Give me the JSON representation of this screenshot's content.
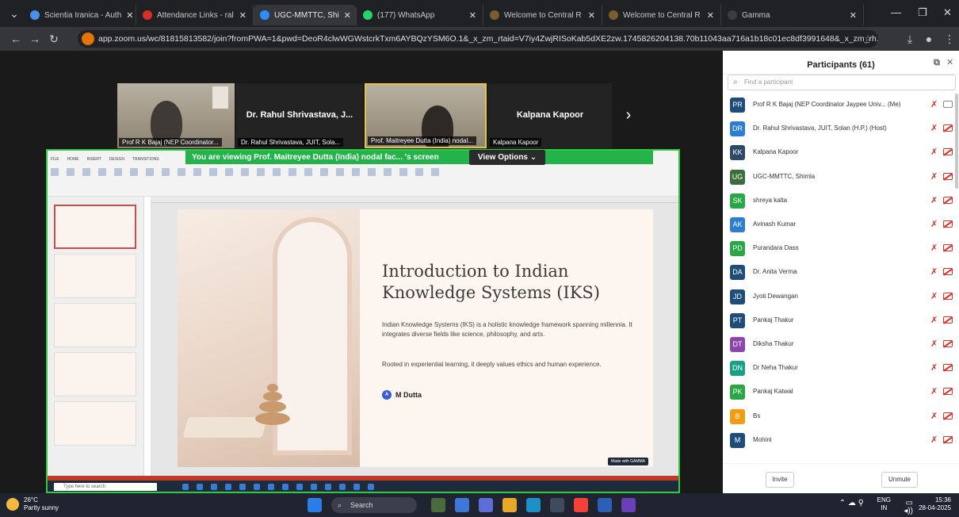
{
  "browser": {
    "tabs": [
      {
        "label": "Scientia Iranica - Auth",
        "color": "#4a8fe8"
      },
      {
        "label": "Attendance Links - ral",
        "color": "#d93025"
      },
      {
        "label": "UGC-MMTTC, Shi",
        "color": "#2d8cff",
        "active": true
      },
      {
        "label": "(177) WhatsApp",
        "color": "#25d366"
      },
      {
        "label": "Welcome to Central R",
        "color": "#7a5c2e"
      },
      {
        "label": "Welcome to Central R",
        "color": "#7a5c2e"
      },
      {
        "label": "Gamma",
        "color": "#3c3c3c"
      }
    ],
    "url": "app.zoom.us/wc/81815813582/join?fromPWA=1&pwd=DeoR4clwWGWstcrkTxm6AYBQzYSM6O.1&_x_zm_rtaid=V7iy4ZwjRISoKab5dXE2zw.1745826204138.70b11043aa716a1b18c01ec8df3991648&_x_zm_rh..."
  },
  "videos": [
    {
      "label": "Prof R K Bajaj (NEP Coordinator..."
    },
    {
      "name": "Dr. Rahul Shrivastava, J...",
      "label": "Dr. Rahul Shrivastava, JUIT, Sola..."
    },
    {
      "label": "Prof. Maitreyee Dutta (India) nodal..."
    },
    {
      "name": "Kalpana Kapoor",
      "label": "Kalpana Kapoor"
    }
  ],
  "share": {
    "banner": "You are viewing Prof. Maitreyee Dutta (India) nodal fac... 's screen",
    "view_options": "View Options",
    "slide": {
      "title": "Introduction to Indian Knowledge Systems (IKS)",
      "para1": "Indian Knowledge Systems (IKS) is a holistic knowledge framework spanning millennia. It integrates diverse fields like science, philosophy, and arts.",
      "para2": "Rooted in experiential learning, it deeply values ethics and human experience.",
      "author_initial": "A",
      "author": "M Dutta",
      "badge": "Made with GAMMA"
    },
    "inner_search": "Type here to search"
  },
  "participants": {
    "title": "Participants (61)",
    "search_placeholder": "Find a participant",
    "list": [
      {
        "initials": "PR",
        "name": "Prof R K Bajaj (NEP Coordinator Jaypee Univ... (Me)",
        "color": "#1e4d7b",
        "cam": "off"
      },
      {
        "initials": "DR",
        "name": "Dr. Rahul Shrivastava, JUIT, Solan (H.P.) (Host)",
        "color": "#2d7dd2",
        "cam": "muted"
      },
      {
        "initials": "KK",
        "name": "Kalpana Kapoor",
        "color": "#2d4a6b",
        "cam": "muted"
      },
      {
        "initials": "UG",
        "name": "UGC-MMTTC, Shimla",
        "color": "#3b6e3b",
        "cam": "muted"
      },
      {
        "initials": "SK",
        "name": "shreya kalta",
        "color": "#28a745",
        "cam": "muted"
      },
      {
        "initials": "AK",
        "name": "Avinash Kumar",
        "color": "#2d7dd2",
        "cam": "muted"
      },
      {
        "initials": "PD",
        "name": "Purandara Dass",
        "color": "#28a745",
        "cam": "muted"
      },
      {
        "initials": "DA",
        "name": "Dr. Anita Verma",
        "color": "#1e4d7b",
        "cam": "muted"
      },
      {
        "initials": "JD",
        "name": "Jyoti Dewangan",
        "color": "#1e4d7b",
        "cam": "muted"
      },
      {
        "initials": "PT",
        "name": "Pankaj Thakur",
        "color": "#1e4d7b",
        "cam": "muted"
      },
      {
        "initials": "DT",
        "name": "Diksha Thakur",
        "color": "#8e44ad",
        "cam": "muted"
      },
      {
        "initials": "DN",
        "name": "Dr Neha Thakur",
        "color": "#16a085",
        "cam": "muted"
      },
      {
        "initials": "PK",
        "name": "Pankaj Katwal",
        "color": "#28a745",
        "cam": "muted"
      },
      {
        "initials": "B",
        "name": "Bs",
        "color": "#f39c12",
        "cam": "muted"
      },
      {
        "initials": "M",
        "name": "Mohini",
        "color": "#1e4d7b",
        "cam": "muted"
      }
    ],
    "invite": "Invite",
    "unmute": "Unmute"
  },
  "taskbar": {
    "temp": "26°C",
    "weather": "Partly sunny",
    "search": "Search",
    "lang": "ENG",
    "region": "IN",
    "time": "15:36",
    "date": "28-04-2025"
  }
}
